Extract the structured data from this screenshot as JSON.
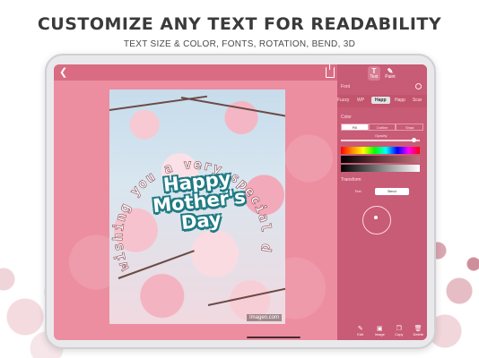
{
  "promo": {
    "headline": "CUSTOMIZE ANY TEXT FOR READABILITY",
    "subheadline": "TEXT SIZE & COLOR, FONTS, ROTATION, BEND, 3D"
  },
  "app": {
    "canvas": {
      "arc_text": "wishing you a very special day",
      "headline_lines": [
        "Happy",
        "Mother's",
        "Day"
      ],
      "photo_credit": "Imagen.com"
    },
    "panel": {
      "tool_tabs": [
        {
          "label": "Text",
          "glyph": "T"
        },
        {
          "label": "Paint",
          "glyph": "✎"
        }
      ],
      "font_section_label": "Font",
      "fonts": [
        "Fuzzy",
        "WP",
        "Happ",
        "Happ",
        "Scar"
      ],
      "selected_font": "Happ",
      "color_section_label": "Color",
      "color_modes": [
        "Fill",
        "Outline",
        "Shad"
      ],
      "active_color_mode": "Fill",
      "opacity_label": "Opacity",
      "opacity_value": 0.95,
      "transform_section_label": "Transform",
      "transform_options": [
        "Text",
        "Bend"
      ],
      "active_transform": "Bend",
      "actions": [
        {
          "label": "Edit",
          "glyph": "✎"
        },
        {
          "label": "Image",
          "glyph": "▣"
        },
        {
          "label": "Copy",
          "glyph": "❐"
        },
        {
          "label": "Delete",
          "glyph": "🗑"
        }
      ]
    }
  },
  "colors": {
    "canvas_bg": "#ec8ea0",
    "panel_bg": "#c85b75",
    "text_outline": "#1f7a84"
  }
}
